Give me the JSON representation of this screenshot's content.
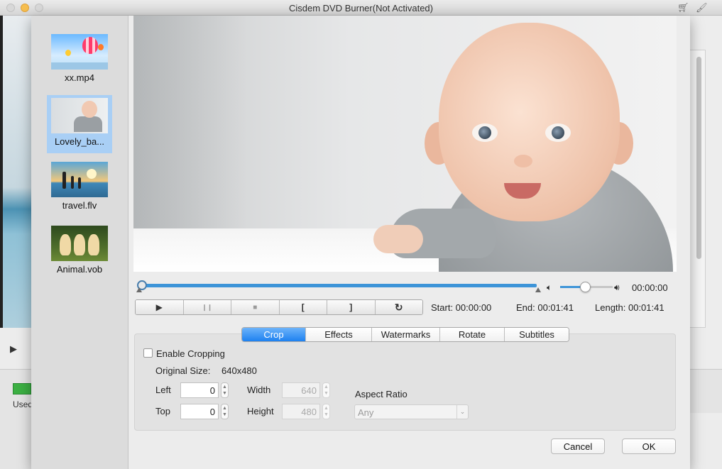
{
  "window": {
    "title": "Cisdem DVD Burner(Not Activated)"
  },
  "titlebar_icons": [
    "cart-icon",
    "brush-icon"
  ],
  "background_window": {
    "used_label": "Used"
  },
  "sidebar": {
    "items": [
      {
        "label": "xx.mp4",
        "thumb": "balloons",
        "selected": false
      },
      {
        "label": "Lovely_ba...",
        "thumb": "baby",
        "selected": true
      },
      {
        "label": "travel.flv",
        "thumb": "travel",
        "selected": false
      },
      {
        "label": "Animal.vob",
        "thumb": "dogs",
        "selected": false
      }
    ]
  },
  "player": {
    "current_time": "00:00:00",
    "progress": 0,
    "volume": 0.5,
    "buttons": {
      "play": "▶",
      "pause": "❙❙",
      "stop": "■",
      "mark_in": "[",
      "mark_out": "]",
      "reset": "↻"
    },
    "start": "Start: 00:00:00",
    "end": "End: 00:01:41",
    "length": "Length: 00:01:41"
  },
  "tabs": [
    {
      "label": "Crop",
      "active": true
    },
    {
      "label": "Effects",
      "active": false
    },
    {
      "label": "Watermarks",
      "active": false
    },
    {
      "label": "Rotate",
      "active": false
    },
    {
      "label": "Subtitles",
      "active": false
    }
  ],
  "crop": {
    "enable_label": "Enable Cropping",
    "enabled": false,
    "original_size_label": "Original Size:",
    "original_size": "640x480",
    "left_label": "Left",
    "left": "0",
    "top_label": "Top",
    "top": "0",
    "width_label": "Width",
    "width": "640",
    "height_label": "Height",
    "height": "480",
    "aspect_ratio_label": "Aspect Ratio",
    "aspect_ratio": "Any"
  },
  "dialog": {
    "cancel_label": "Cancel",
    "ok_label": "OK"
  },
  "colors": {
    "accent": "#1e81f0",
    "progress": "#3d94d8",
    "selection": "#a9cff5"
  }
}
